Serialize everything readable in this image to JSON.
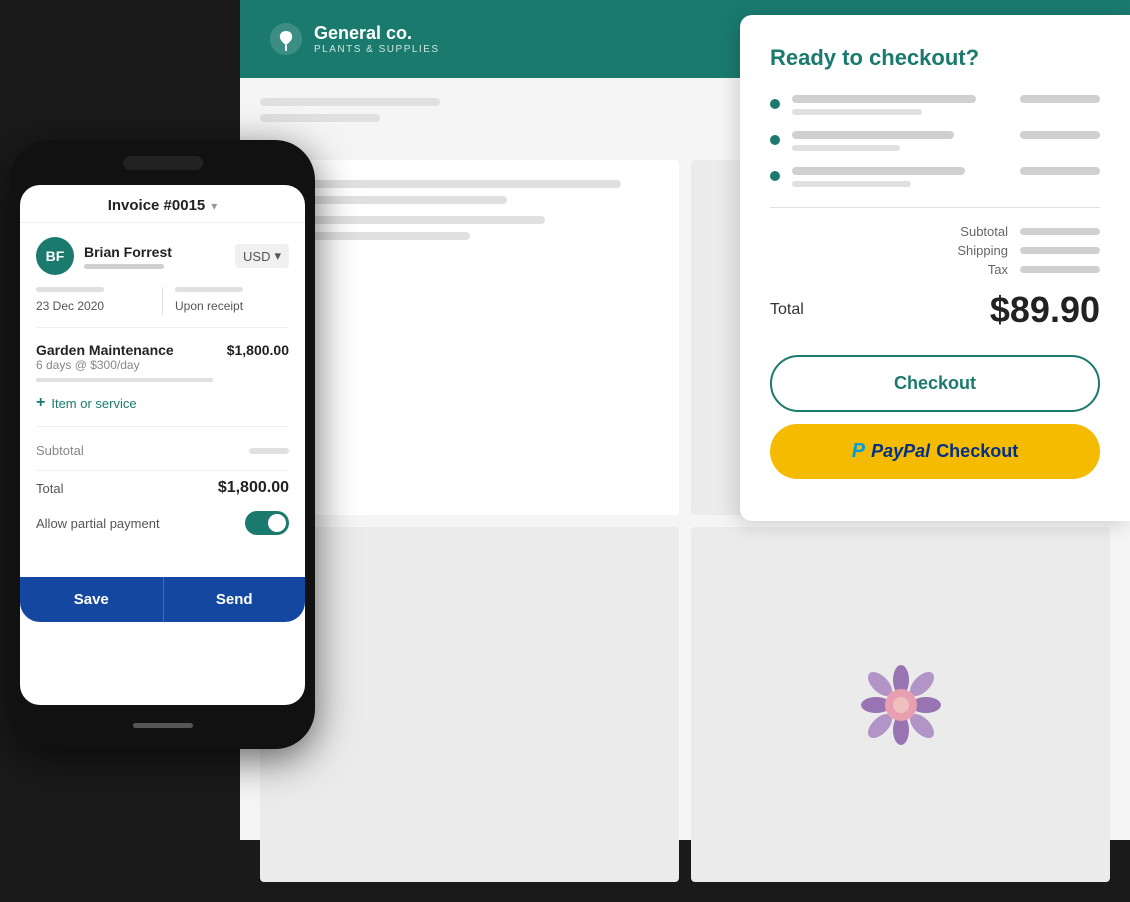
{
  "brand": {
    "name": "General co.",
    "subtitle": "PLANTS & SUPPLIES"
  },
  "checkout": {
    "title": "Ready to checkout?",
    "total_label": "Total",
    "total_amount": "$89.90",
    "subtotal_label": "Subtotal",
    "shipping_label": "Shipping",
    "tax_label": "Tax",
    "checkout_btn_label": "Checkout",
    "paypal_btn_label": "Checkout"
  },
  "invoice": {
    "title": "Invoice #0015",
    "client_name": "Brian Forrest",
    "currency": "USD",
    "date_value": "23 Dec 2020",
    "due_label": "Upon receipt",
    "line_item_name": "Garden Maintenance",
    "line_item_amount": "$1,800.00",
    "line_item_desc": "6 days @ $300/day",
    "add_item_label": "Item or service",
    "subtotal_label": "Subtotal",
    "total_label": "Total",
    "total_amount": "$1,800.00",
    "partial_payment_label": "Allow partial payment",
    "save_btn": "Save",
    "send_btn": "Send"
  }
}
